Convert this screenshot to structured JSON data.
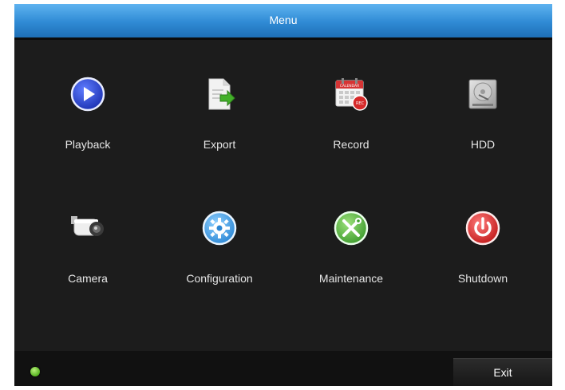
{
  "window": {
    "title": "Menu"
  },
  "menu": {
    "items": [
      {
        "label": "Playback",
        "icon": "playback-icon"
      },
      {
        "label": "Export",
        "icon": "export-icon"
      },
      {
        "label": "Record",
        "icon": "record-calendar-icon"
      },
      {
        "label": "HDD",
        "icon": "hdd-icon"
      },
      {
        "label": "Camera",
        "icon": "camera-icon"
      },
      {
        "label": "Configuration",
        "icon": "gear-icon"
      },
      {
        "label": "Maintenance",
        "icon": "tools-icon"
      },
      {
        "label": "Shutdown",
        "icon": "power-icon"
      }
    ],
    "calendar_icon_text": "CALENDAR",
    "rec_badge_text": "REC"
  },
  "footer": {
    "exit_label": "Exit",
    "status_color": "#56b320"
  },
  "colors": {
    "title_bar": "#2f8ad4",
    "background": "#1c1c1c",
    "power_red": "#d42a2a",
    "play_blue": "#2340c8",
    "tools_green": "#4aa83a"
  }
}
